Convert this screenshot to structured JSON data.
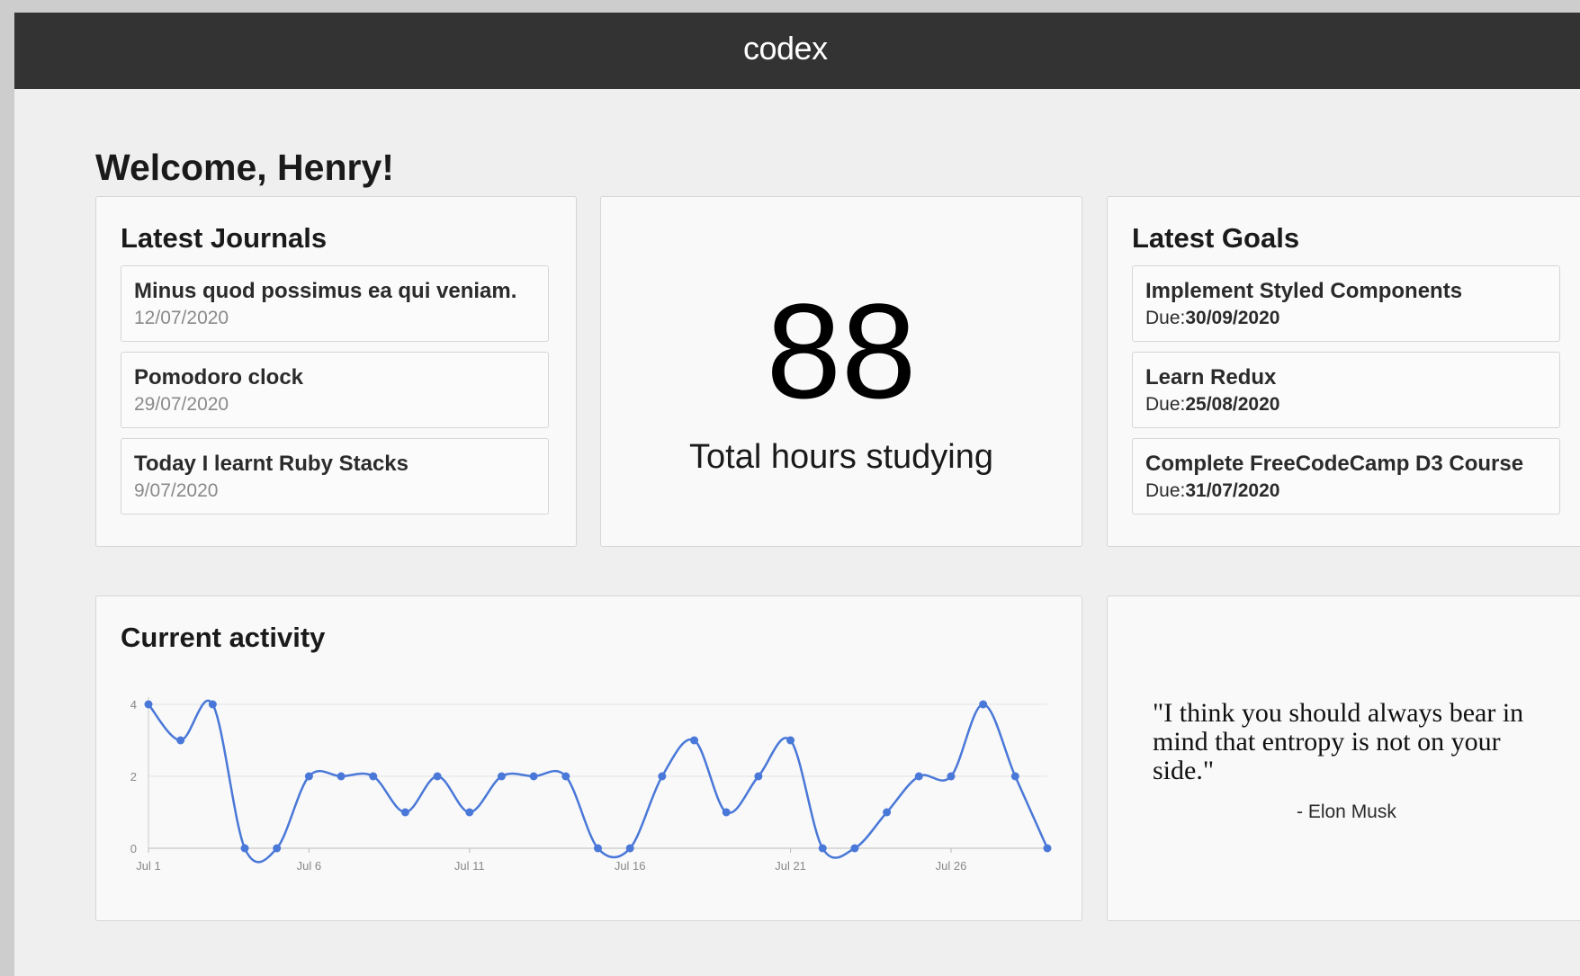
{
  "header": {
    "brand": "codex"
  },
  "welcome": "Welcome, Henry!",
  "journals": {
    "title": "Latest Journals",
    "items": [
      {
        "title": "Minus quod possimus ea qui veniam.",
        "date": "12/07/2020"
      },
      {
        "title": "Pomodoro clock",
        "date": "29/07/2020"
      },
      {
        "title": "Today I learnt Ruby Stacks",
        "date": "9/07/2020"
      }
    ]
  },
  "stats": {
    "value": "88",
    "label": "Total hours studying"
  },
  "goals": {
    "title": "Latest Goals",
    "due_label": "Due:",
    "items": [
      {
        "title": "Implement Styled Components",
        "due": "30/09/2020"
      },
      {
        "title": "Learn Redux",
        "due": "25/08/2020"
      },
      {
        "title": "Complete FreeCodeCamp D3 Course",
        "due": "31/07/2020"
      }
    ]
  },
  "activity": {
    "title": "Current activity"
  },
  "quote": {
    "text": "\"I think you should always bear in mind that entropy is not on your side.\"",
    "author": "- Elon Musk"
  },
  "colors": {
    "topbar": "#333333",
    "line": "#4a78d8",
    "background": "#efefef",
    "card": "#f9f9f9"
  },
  "chart_data": {
    "type": "line",
    "x": [
      1,
      2,
      3,
      4,
      5,
      6,
      7,
      8,
      9,
      10,
      11,
      12,
      13,
      14,
      15,
      16,
      17,
      18,
      19,
      20,
      21,
      22,
      23,
      24,
      25,
      26,
      27,
      28,
      29
    ],
    "x_tick_labels": [
      "Jul 1",
      "Jul 6",
      "Jul 11",
      "Jul 16",
      "Jul 21",
      "Jul 26"
    ],
    "x_tick_values": [
      1,
      6,
      11,
      16,
      21,
      26
    ],
    "series": [
      {
        "values": [
          4,
          3,
          4,
          0,
          0,
          2,
          2,
          2,
          1,
          2,
          1,
          2,
          2,
          2,
          0,
          0,
          2,
          3,
          1,
          2,
          3,
          0,
          0,
          1,
          2,
          2,
          4,
          2,
          0
        ]
      }
    ],
    "y_ticks": [
      0,
      2,
      4
    ],
    "xlim": [
      1,
      29
    ],
    "ylim": [
      0,
      4
    ],
    "grid": true
  }
}
